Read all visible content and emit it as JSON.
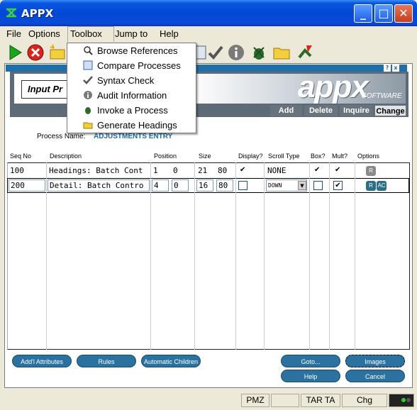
{
  "window": {
    "title": "APPX",
    "minimize": "_",
    "maximize": "□",
    "close": "✕"
  },
  "menubar": {
    "items": [
      "File",
      "Options",
      "Toolbox",
      "Jump to",
      "Help"
    ]
  },
  "dropdown": {
    "items": [
      "Browse References",
      "Compare Processes",
      "Syntax Check",
      "Audit Information",
      "Invoke a Process",
      "Generate Headings"
    ]
  },
  "banner": {
    "tab": "Input Pr",
    "logo": "appx",
    "logo_sub": "SOFTWARE",
    "help": "?",
    "close": "x"
  },
  "modes": [
    "Add",
    "Delete",
    "Inquire",
    "Change"
  ],
  "process": {
    "label": "Process Name:",
    "value": "ADJUSTMENTS ENTRY"
  },
  "columns": [
    "Seq No",
    "Description",
    "Position",
    "Size",
    "Display?",
    "Scroll Type",
    "Box?",
    "Mult?",
    "Options"
  ],
  "rows": [
    {
      "seq": "100",
      "desc": "Headings: Batch Cont",
      "pos1": "1",
      "pos2": "0",
      "size1": "21",
      "size2": "80",
      "display": "✔",
      "scroll": "NONE",
      "box": "✔",
      "mult": "✔",
      "options": [
        "R"
      ]
    },
    {
      "seq": "200",
      "desc": "Detail: Batch Contro",
      "pos1": "4",
      "pos2": "0",
      "size1": "16",
      "size2": "80",
      "display": "",
      "scroll": "DOWN",
      "box": "",
      "mult": "✔",
      "options": [
        "R",
        "AC"
      ]
    }
  ],
  "buttons": {
    "attrs": "Add'l Attributes",
    "rules": "Rules",
    "children": "Automatic Children",
    "goto": "Goto...",
    "images": "Images",
    "help": "Help",
    "cancel": "Cancel"
  },
  "status": {
    "pmz": "PMZ",
    "tar": "TAR TA",
    "chg": "Chg"
  }
}
